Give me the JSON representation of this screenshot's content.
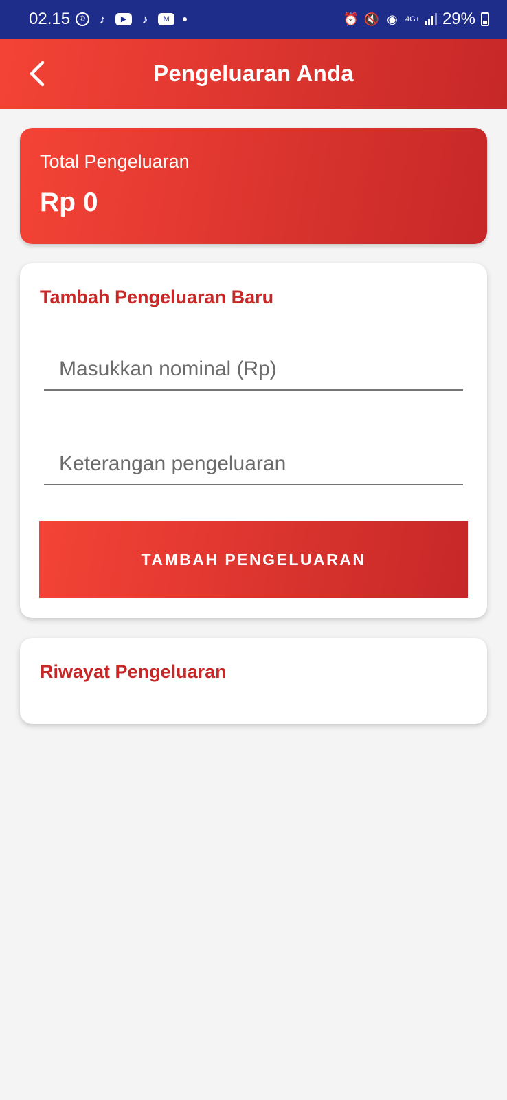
{
  "status_bar": {
    "time": "02.15",
    "battery": "29%",
    "network": "4G+",
    "icons": [
      "whatsapp-icon",
      "tiktok-icon",
      "youtube-icon",
      "tiktok-icon",
      "gmail-icon",
      "alarm-icon",
      "mute-icon",
      "hotspot-icon",
      "signal-icon",
      "battery-icon"
    ]
  },
  "app_bar": {
    "title": "Pengeluaran Anda",
    "back_icon": "chevron-left-icon"
  },
  "summary": {
    "label": "Total Pengeluaran",
    "value": "Rp 0"
  },
  "add_form": {
    "heading": "Tambah Pengeluaran Baru",
    "amount_placeholder": "Masukkan nominal (Rp)",
    "amount_value": "",
    "note_placeholder": "Keterangan pengeluaran",
    "note_value": "",
    "submit_label": "TAMBAH PENGELUARAN"
  },
  "history": {
    "heading": "Riwayat Pengeluaran"
  },
  "colors": {
    "status_bar": "#1f2d8a",
    "primary_start": "#f44336",
    "primary_end": "#c62828",
    "heading_red": "#c62828",
    "background": "#f4f4f4"
  }
}
